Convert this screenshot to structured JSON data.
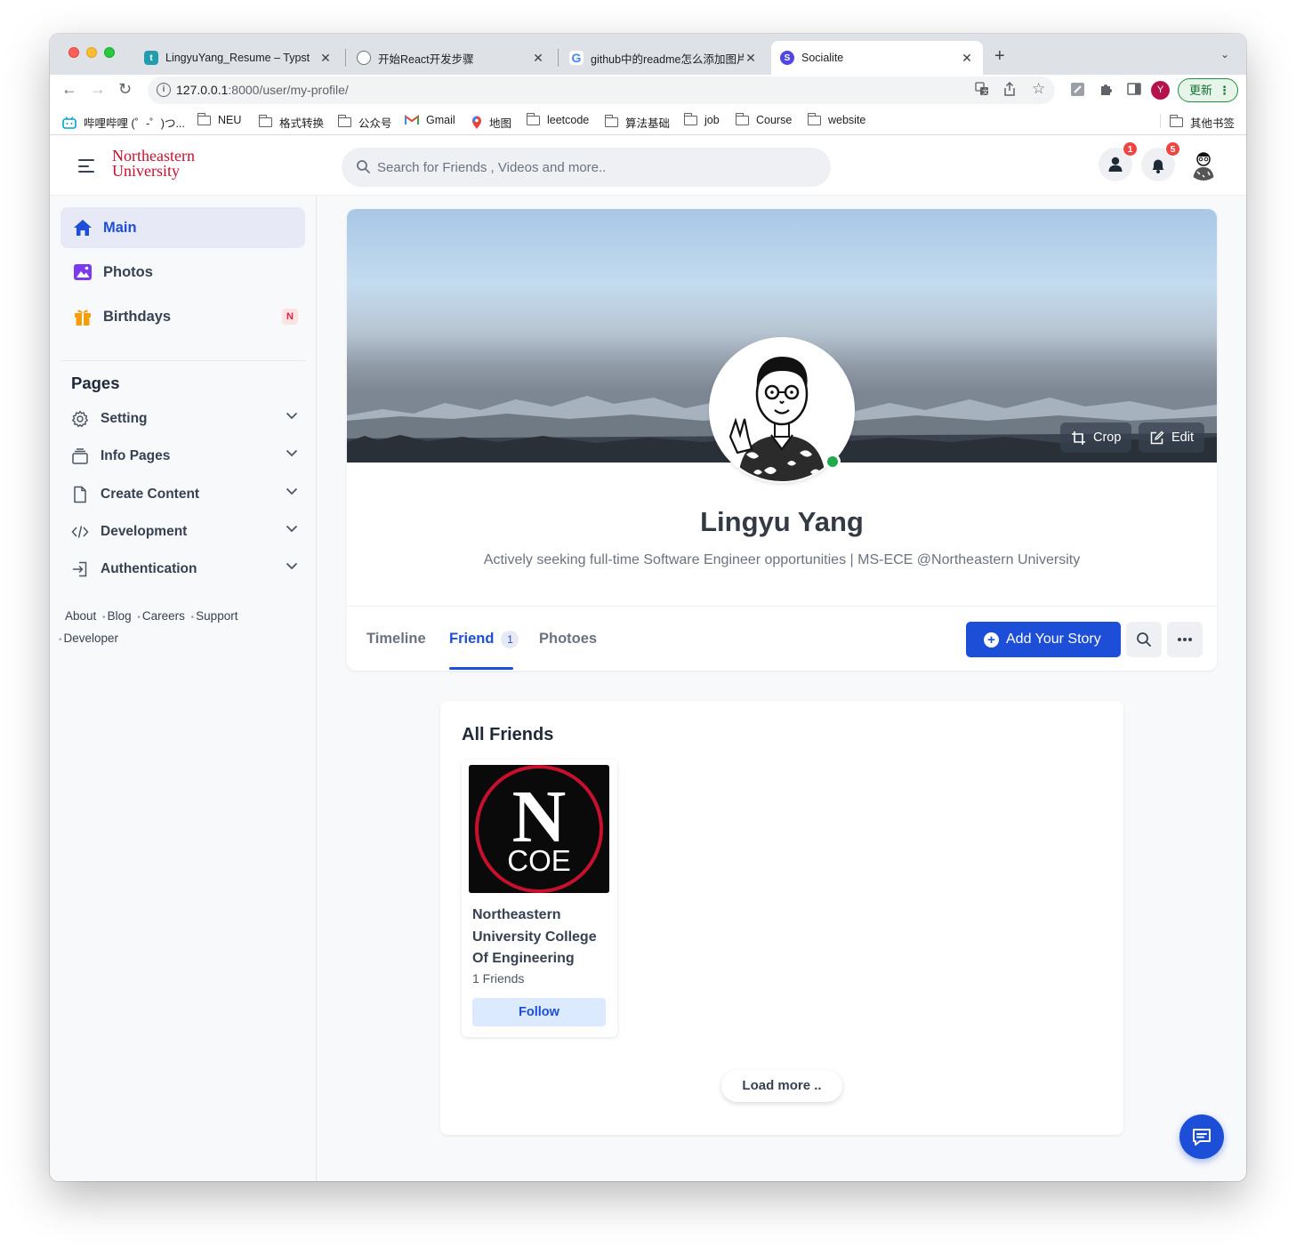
{
  "browser": {
    "tabs": [
      {
        "title": "LingyuYang_Resume – Typst",
        "favicon_letter": "t",
        "favicon_color": "#239dad"
      },
      {
        "title": "开始React开发步骤",
        "favicon_letter": "",
        "favicon_color": "#6b7280"
      },
      {
        "title": "github中的readme怎么添加图片",
        "favicon_letter": "G",
        "favicon_color": "#4285f4"
      },
      {
        "title": "Socialite",
        "favicon_letter": "S",
        "favicon_color": "#4f46e5"
      }
    ],
    "url_host": "127.0.0.1",
    "url_rest": ":8000/user/my-profile/",
    "profile_initial": "Y",
    "update_label": "更新",
    "bookmarks": [
      "哔哩哔哩 (゜-゜)つ...",
      "NEU",
      "格式转换",
      "公众号",
      "Gmail",
      "地图",
      "leetcode",
      "算法基础",
      "job",
      "Course",
      "website"
    ],
    "other_bookmarks": "其他书签"
  },
  "header": {
    "logo_line1": "Northeastern",
    "logo_line2": "University",
    "search_placeholder": "Search for Friends , Videos and more..",
    "friend_requests_count": "1",
    "notifications_count": "5"
  },
  "sidebar": {
    "items": [
      {
        "label": "Main",
        "active": true
      },
      {
        "label": "Photos",
        "active": false
      },
      {
        "label": "Birthdays",
        "active": false,
        "badge": "N"
      }
    ],
    "pages_title": "Pages",
    "pages": [
      {
        "label": "Setting"
      },
      {
        "label": "Info Pages"
      },
      {
        "label": "Create Content"
      },
      {
        "label": "Development"
      },
      {
        "label": "Authentication"
      }
    ],
    "footer_links": [
      "About",
      "Blog",
      "Careers",
      "Support",
      "Developer"
    ]
  },
  "profile": {
    "crop_label": "Crop",
    "edit_label": "Edit",
    "name": "Lingyu Yang",
    "bio": "Actively seeking full-time Software Engineer opportunities | MS-ECE @Northeastern University",
    "tabs": [
      {
        "label": "Timeline"
      },
      {
        "label": "Friend",
        "count": "1",
        "active": true
      },
      {
        "label": "Photoes"
      }
    ],
    "add_story_label": "Add Your Story"
  },
  "friends": {
    "title": "All Friends",
    "list": [
      {
        "name": "Northeastern University College Of Engineering",
        "friends_count": "1 Friends",
        "follow_label": "Follow",
        "logo_letter": "N",
        "logo_text": "COE"
      }
    ],
    "load_more_label": "Load more .."
  },
  "colors": {
    "accent": "#1d4ed8",
    "brand_red": "#c8102e",
    "badge_red": "#ef4444",
    "online_green": "#22a94f"
  }
}
